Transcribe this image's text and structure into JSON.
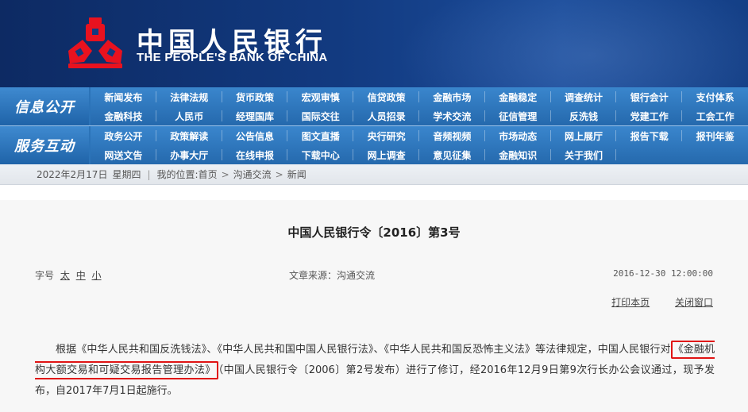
{
  "header": {
    "cn_name": "中国人民银行",
    "en_name": "THE PEOPLE'S BANK OF CHINA",
    "logo_color": "#e8121f"
  },
  "nav": {
    "section1_label": "信息公开",
    "section2_label": "服务互动",
    "row1_items": [
      "新闻发布",
      "法律法规",
      "货币政策",
      "宏观审慎",
      "信贷政策",
      "金融市场",
      "金融稳定",
      "调查统计",
      "银行会计",
      "支付体系",
      "金融科技",
      "人民币",
      "经理国库",
      "国际交往",
      "人员招录",
      "学术交流",
      "征信管理",
      "反洗钱",
      "党建工作",
      "工会工作"
    ],
    "row2_items": [
      "政务公开",
      "政策解读",
      "公告信息",
      "图文直播",
      "央行研究",
      "音频视频",
      "市场动态",
      "网上展厅",
      "报告下载",
      "报刊年鉴",
      "网送文告",
      "办事大厅",
      "在线申报",
      "下载中心",
      "网上调查",
      "意见征集",
      "金融知识",
      "关于我们"
    ]
  },
  "breadcrumb": {
    "date": "2022年2月17日",
    "weekday": "星期四",
    "location_prefix": "我的位置:",
    "home": "首页",
    "level1": "沟通交流",
    "level2": "新闻",
    "arrow": ">"
  },
  "article": {
    "title": "中国人民银行令〔2016〕第3号",
    "font_size_label": "字号",
    "font_sizes": [
      "太",
      "中",
      "小"
    ],
    "source_label": "文章来源：",
    "source": "沟通交流",
    "datetime": "2016-12-30 12:00:00",
    "print_label": "打印本页",
    "close_label": "关闭窗口",
    "body_part1": "根据《中华人民共和国反洗钱法》、《中华人民共和国中国人民银行法》、《中华人民共和国反恐怖主义法》等法律规定，中国人民银行对",
    "body_highlight": "《金融机构大额交易和可疑交易报告管理办法》",
    "body_part2": "（中国人民银行令〔2006〕第2号发布）进行了修订，经2016年12月9日第9次行长办公会议通过，现予发布，自2017年7月1日起施行。",
    "highlight_color": "#e01414"
  }
}
